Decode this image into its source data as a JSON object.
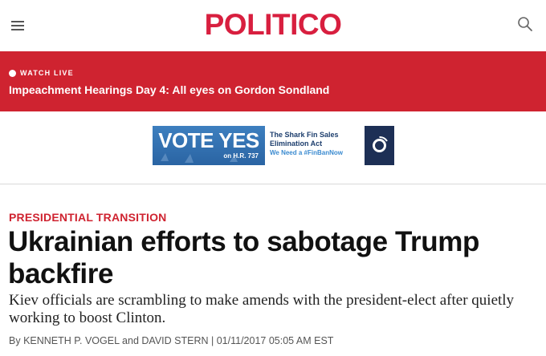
{
  "header": {
    "logo_text": "POLITICO",
    "menu_icon": "hamburger-menu-icon",
    "search_icon": "search-icon",
    "brand_color": "#d81f3f"
  },
  "live_banner": {
    "label": "WATCH LIVE",
    "headline": "Impeachment Hearings Day 4: All eyes on Gordon Sondland",
    "background_color": "#cf2330"
  },
  "ad": {
    "vote_title": "VOTE YES",
    "vote_sub": "on H.R. 737",
    "title": "The Shark Fin Sales Elimination Act",
    "hashtag": "We Need a #FinBanNow",
    "badge_icon": "org-logo-icon"
  },
  "article": {
    "kicker": "PRESIDENTIAL TRANSITION",
    "headline": "Ukrainian efforts to sabotage Trump backfire",
    "dek": "Kiev officials are scrambling to make amends with the president-elect after quietly working to boost Clinton.",
    "byline_prefix": "By",
    "author_1": "KENNETH P. VOGEL",
    "author_join": "and",
    "author_2": "DAVID STERN",
    "separator": "|",
    "timestamp": "01/11/2017 05:05 AM EST"
  }
}
